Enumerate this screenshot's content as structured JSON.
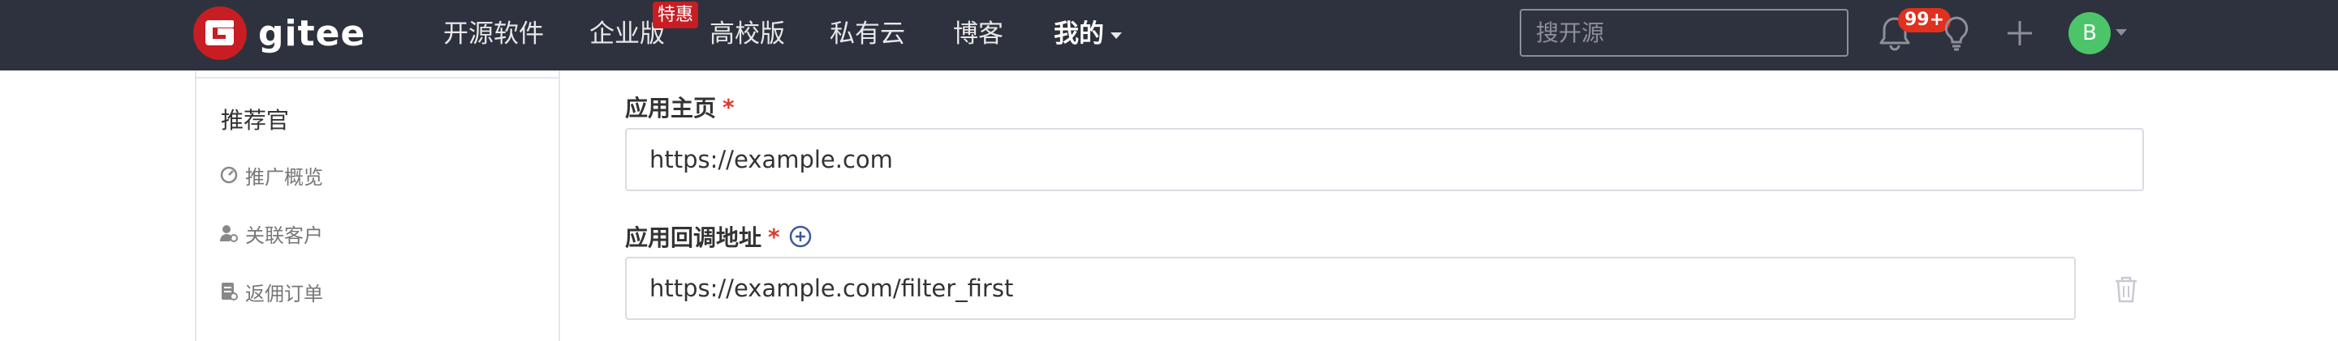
{
  "brand": {
    "name": "gitee"
  },
  "nav": {
    "items": [
      {
        "label": "开源软件"
      },
      {
        "label": "企业版"
      },
      {
        "label": "高校版"
      },
      {
        "label": "私有云"
      },
      {
        "label": "博客"
      },
      {
        "label": "我的"
      }
    ],
    "badge": "特惠"
  },
  "search": {
    "placeholder": "搜开源",
    "value": ""
  },
  "notifications": {
    "count": "99+"
  },
  "user": {
    "avatar_letter": "B"
  },
  "sidebar": {
    "title": "推荐官",
    "items": [
      {
        "label": "推广概览",
        "icon": "gauge-icon"
      },
      {
        "label": "关联客户",
        "icon": "user-link-icon"
      },
      {
        "label": "返佣订单",
        "icon": "order-icon"
      }
    ]
  },
  "form": {
    "homepage": {
      "label": "应用主页",
      "required_mark": "*",
      "value": "https://example.com"
    },
    "callback": {
      "label": "应用回调地址",
      "required_mark": "*",
      "value": "https://example.com/filter_first"
    }
  },
  "colors": {
    "topbar": "#2e323e",
    "brand_red": "#c71d23",
    "required": "#e03a2f",
    "avatar": "#4cc46a"
  }
}
